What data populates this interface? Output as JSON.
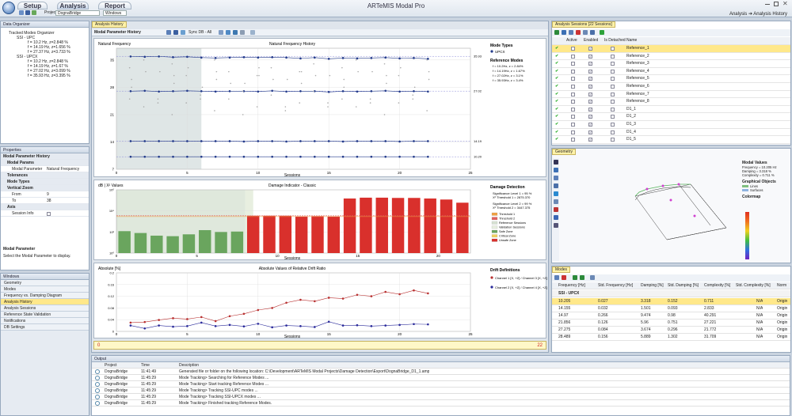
{
  "app": {
    "title": "ARTeMIS Modal Pro",
    "tabs": [
      "Setup",
      "Analysis",
      "Report"
    ],
    "project_label": "Project:",
    "project_value": "DognaBridge",
    "window_label": "Windows",
    "breadcrumb": "Analysis ➔ Analysis History"
  },
  "data_organizer": {
    "title": "Data Organizer",
    "tree": [
      "Tracked Modes Organizer",
      "SSI - UPC",
      "f = 10.2 Hz, z=2.848 %",
      "f = 14.19 Hz, z=1.656 %",
      "f = 27.37 Hz, z=3.733 %",
      "SSI - UPCX",
      "f = 10.2 Hz, z=2.848 %",
      "f = 14.19 Hz, z=1.67 %",
      "f = 27.02 Hz, z=3.099 %",
      "f = 35.93 Hz, z=3.395 %"
    ]
  },
  "properties": {
    "title": "Properties",
    "header": "Modal Parameter History",
    "sections": {
      "modal_params": "Modal Params",
      "tolerances": "Tolerances",
      "mode_types": "Mode Types",
      "vertical_zoom": "Vertical Zoom",
      "axis": "Axis"
    },
    "modal_param_label": "Modal Parameter",
    "modal_param_value": "Natural Frequency",
    "from_label": "From",
    "from_value": "9",
    "to_label": "To",
    "to_value": "38",
    "session_info": "Session Info",
    "desc_title": "Modal Parameter",
    "desc_text": "Select the Modal Parameter to display."
  },
  "windows": {
    "title": "Windows",
    "items": [
      "Geometry",
      "Modes",
      "Frequency vs. Damping Diagram",
      "Analysis History",
      "Analysis Sessions",
      "Reference State Validation",
      "Notifications",
      "DB Settings"
    ]
  },
  "history": {
    "tab": "Analysis History",
    "toolbar_label": "Modal Parameter History",
    "sync_label": "Sync DB - All"
  },
  "chart1": {
    "ylabel": "Natural Frequency",
    "title": "Natural Frequency History",
    "xlabel": "Sessions",
    "right_labels": [
      "35.93",
      "27.02",
      "14.19",
      "10.20"
    ],
    "legend_title": "Mode Types",
    "legend_item": "UPCX",
    "ref_title": "Reference Modes",
    "ref_items": [
      "f = 10.2Hz, z = 2.84%",
      "f = 14.19Hz, z = 1.67%",
      "f = 27.02Hz, z = 3.1%",
      "f = 35.93Hz, z = 3.4%"
    ]
  },
  "chart2": {
    "ylabel": "dB | X² Values",
    "title": "Damage Indicator - Classic",
    "xlabel": "Sessions",
    "legend_title": "Damage Detection",
    "sig1": "Significance Level 1 = 95 %",
    "thr1": "X² Threshold 1 = 2875.370",
    "sig2": "Significance Level 2 = 99 %",
    "thr2": "X² Threshold 2 = 3447.375",
    "legend_items": [
      "Threshold 1",
      "Threshold 2",
      "Reference Sessions",
      "Validation Sessions",
      "Safe Zone",
      "Critical Zone",
      "Unsafe Zone"
    ]
  },
  "chart3": {
    "ylabel": "Absolute [%]",
    "title": "Absolute Values of Relative Drift Ratio",
    "xlabel": "Sessions",
    "legend_title": "Drift Definitions",
    "legend_items": [
      "Channel 1 [X, +Z] / Channel 3 [X, +Z]",
      "Channel 2 [X, +Z] / Channel 4 [X, +Z]"
    ]
  },
  "progress": {
    "start": "0",
    "end": "22"
  },
  "sessions": {
    "title": "Analysis Sessions [22 Sessions]",
    "columns": [
      "Active",
      "Enabled",
      "Is Detached",
      "Name"
    ],
    "rows": [
      "Reference_1",
      "Reference_2",
      "Reference_3",
      "Reference_4",
      "Reference_5",
      "Reference_6",
      "Reference_7",
      "Reference_8",
      "D1_1",
      "D1_2",
      "D1_3",
      "D1_4",
      "D1_5"
    ]
  },
  "geometry": {
    "title": "Geometry",
    "modal_values_title": "Modal Values",
    "freq": "Frequency = 10.205 Hz",
    "damp": "Damping = 3.318 %",
    "compl": "Complexity = 0.711 %",
    "graphical_title": "Graphical Objects",
    "g_lines": "Lines",
    "g_surfaces": "Surfaces",
    "colormap_title": "Colormap"
  },
  "modes": {
    "title": "Modes",
    "columns": [
      "Frequency [Hz]",
      "Std. Frequency [Hz]",
      "Damping [%]",
      "Std. Damping [%]",
      "Complexity [%]",
      "Std. Complexity [%]",
      "Norm"
    ],
    "group": "SSI - UPCX",
    "rows": [
      [
        "10.205",
        "0.027",
        "3.318",
        "0.152",
        "0.711",
        "N/A",
        "Origin"
      ],
      [
        "14.155",
        "0.032",
        "1.501",
        "0.093",
        "2.833",
        "N/A",
        "Origin"
      ],
      [
        "14.97",
        "0.266",
        "9.474",
        "0.98",
        "40.291",
        "N/A",
        "Origin"
      ],
      [
        "21.856",
        "0.126",
        "5.96",
        "0.751",
        "27.221",
        "N/A",
        "Origin"
      ],
      [
        "27.275",
        "0.084",
        "3.674",
        "0.296",
        "21.772",
        "N/A",
        "Origin"
      ],
      [
        "28.489",
        "0.156",
        "5.889",
        "1.302",
        "31.709",
        "N/A",
        "Origin"
      ]
    ]
  },
  "output": {
    "title": "Output",
    "columns": [
      "Project",
      "Time",
      "Description"
    ],
    "rows": [
      [
        "DognaBridge",
        "11:41:49",
        "Generated file or folder on the following location: C:\\Development\\ARTeMIS Modal Projects\\Damage Detection\\Export\\DognaBridge_D1_1.amp"
      ],
      [
        "DognaBridge",
        "11:45:29",
        "Mode Tracking> Searching for Reference Modes ..."
      ],
      [
        "DognaBridge",
        "11:45:29",
        "Mode Tracking> Start tracking Reference Modes ..."
      ],
      [
        "DognaBridge",
        "11:45:29",
        "Mode Tracking> Tracking SSI-UPC modes ..."
      ],
      [
        "DognaBridge",
        "11:45:29",
        "Mode Tracking> Tracking SSI-UPCX modes ..."
      ],
      [
        "DognaBridge",
        "11:45:29",
        "Mode Tracking> Finished tracking Reference Modes."
      ]
    ]
  },
  "chart_data": [
    {
      "type": "line",
      "title": "Natural Frequency History",
      "xlabel": "Sessions",
      "ylabel": "Natural Frequency",
      "xlim": [
        0,
        25
      ],
      "ylim": [
        7,
        38
      ],
      "x": [
        1,
        2,
        3,
        4,
        5,
        6,
        7,
        8,
        9,
        10,
        11,
        12,
        13,
        14,
        15,
        16,
        17,
        18,
        19,
        20,
        21,
        22
      ],
      "series": [
        {
          "values": [
            35.9,
            35.8,
            35.9,
            35.7,
            35.8,
            35.6,
            35.5,
            35.6,
            35.7,
            35.6,
            35.7,
            35.6,
            35.4,
            35.6,
            35.3,
            35.5,
            35.4,
            35.5,
            35.6,
            35.4,
            35.5,
            35.3
          ]
        },
        {
          "values": [
            27.0,
            27.1,
            26.9,
            27.0,
            27.1,
            27.0,
            26.9,
            27.0,
            27.0,
            26.9,
            27.1,
            26.9,
            27.0,
            27.0,
            26.8,
            27.0,
            26.9,
            27.0,
            27.1,
            26.9,
            27.0,
            26.9
          ]
        },
        {
          "values": [
            14.2,
            14.2,
            14.2,
            14.2,
            14.2,
            14.2,
            14.2,
            14.2,
            14.1,
            14.2,
            14.2,
            14.1,
            14.2,
            14.2,
            14.2,
            14.1,
            14.2,
            14.2,
            14.2,
            14.1,
            14.2,
            14.2
          ]
        },
        {
          "values": [
            10.2,
            10.2,
            10.2,
            10.2,
            10.2,
            10.2,
            10.2,
            10.2,
            10.2,
            10.2,
            10.2,
            10.2,
            10.2,
            10.2,
            10.2,
            10.2,
            10.2,
            10.2,
            10.2,
            10.2,
            10.2,
            10.2
          ]
        }
      ]
    },
    {
      "type": "bar",
      "title": "Damage Indicator - Classic",
      "xlabel": "Sessions",
      "ylabel": "dB | X² Values",
      "yscale": "log",
      "ylim": [
        1,
        1000000
      ],
      "x": [
        1,
        2,
        3,
        4,
        5,
        6,
        7,
        8,
        9,
        10,
        11,
        12,
        13,
        14,
        15,
        16,
        17,
        18,
        19,
        20,
        21,
        22
      ],
      "values": [
        120,
        80,
        45,
        40,
        60,
        150,
        100,
        110,
        3500,
        3500,
        3500,
        3000,
        3200,
        3000,
        150000,
        180000,
        180000,
        170000,
        170000,
        150000,
        120000,
        60000
      ],
      "reference_sessions": 8
    },
    {
      "type": "line",
      "title": "Absolute Values of Relative Drift Ratio",
      "xlabel": "Sessions",
      "ylabel": "Absolute [%]",
      "xlim": [
        0,
        25
      ],
      "ylim": [
        0,
        0.2
      ],
      "x": [
        1,
        2,
        3,
        4,
        5,
        6,
        7,
        8,
        9,
        10,
        11,
        12,
        13,
        14,
        15,
        16,
        17,
        18,
        19,
        20,
        21,
        22
      ],
      "series": [
        {
          "name": "Channel 1 [X, +Z] / Channel 3 [X, +Z]",
          "values": [
            0.03,
            0.032,
            0.039,
            0.045,
            0.042,
            0.049,
            0.035,
            0.052,
            0.06,
            0.073,
            0.08,
            0.098,
            0.108,
            0.103,
            0.115,
            0.112,
            0.125,
            0.12,
            0.135,
            0.127,
            0.14,
            0.13
          ]
        },
        {
          "name": "Channel 2 [X, +Z] / Channel 4 [X, +Z]",
          "values": [
            0.02,
            0.01,
            0.02,
            0.016,
            0.018,
            0.03,
            0.018,
            0.022,
            0.017,
            0.026,
            0.014,
            0.02,
            0.018,
            0.015,
            0.033,
            0.02,
            0.021,
            0.018,
            0.02,
            0.022,
            0.025,
            0.024
          ]
        }
      ]
    }
  ]
}
